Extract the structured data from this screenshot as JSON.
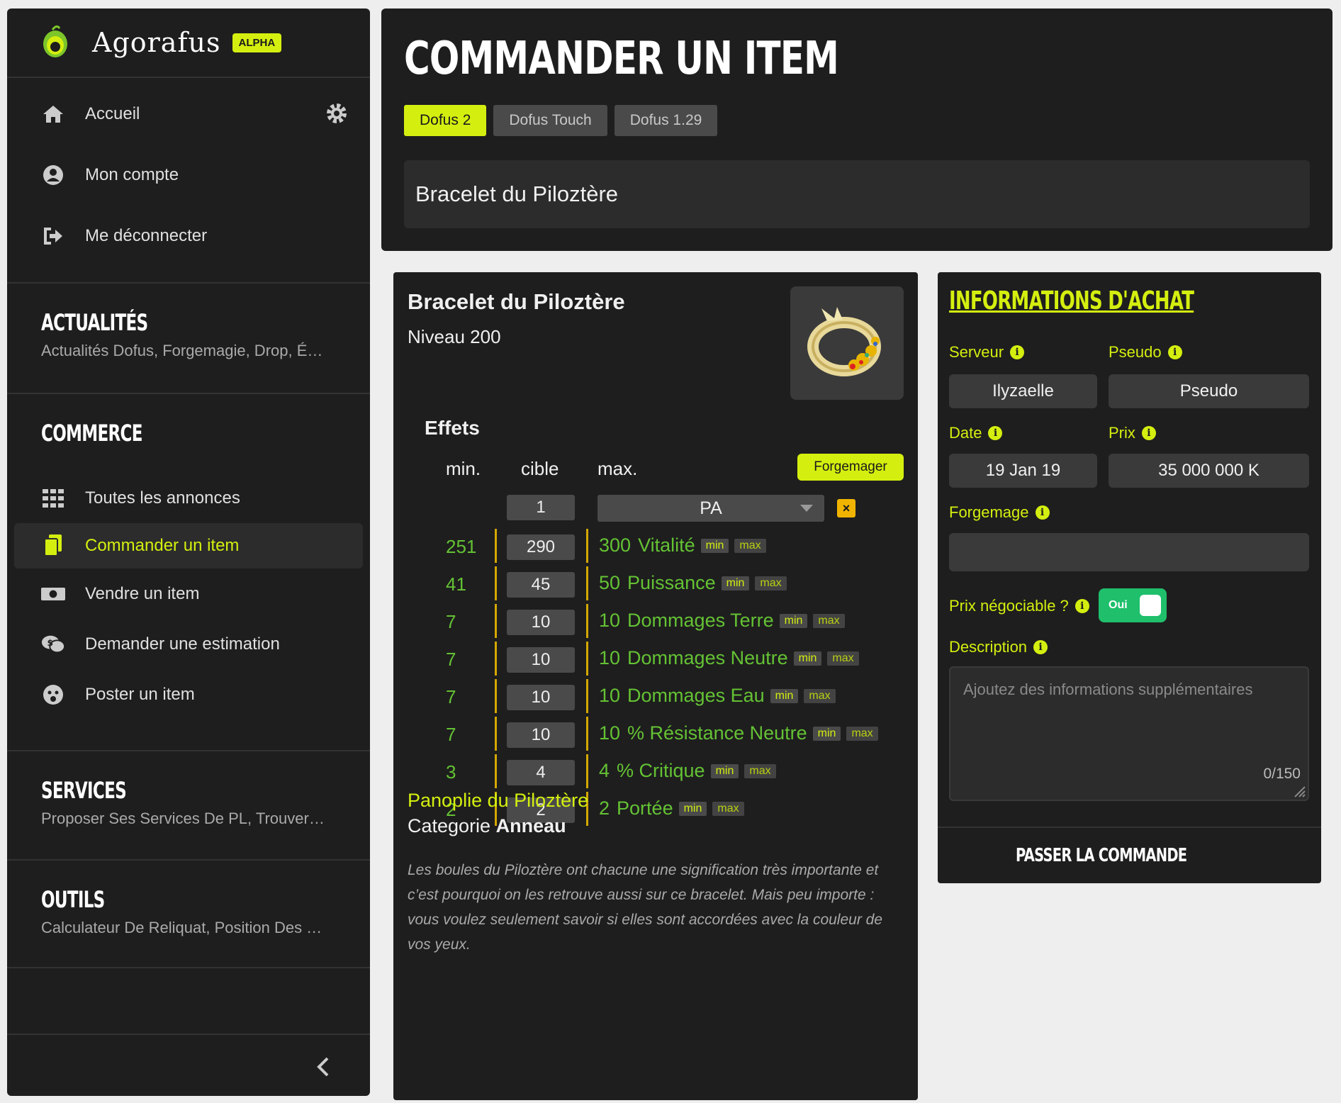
{
  "app": {
    "name": "Agorafus",
    "badge": "ALPHA",
    "accent": "#d4ef0f",
    "success": "#1fbf6b"
  },
  "sidebar": {
    "nav": [
      {
        "label": "Accueil",
        "icon": "home-icon"
      },
      {
        "label": "Mon compte",
        "icon": "user-circle-icon"
      },
      {
        "label": "Me déconnecter",
        "icon": "logout-icon"
      }
    ],
    "news": {
      "title": "ACTUALITÉS",
      "subtitle": "Actualités Dofus, Forgemagie, Drop, É…"
    },
    "commerce": {
      "title": "COMMERCE",
      "items": [
        {
          "label": "Toutes les annonces",
          "icon": "grid-icon"
        },
        {
          "label": "Commander un item",
          "icon": "copy-icon",
          "active": true
        },
        {
          "label": "Vendre un item",
          "icon": "money-icon"
        },
        {
          "label": "Demander une estimation",
          "icon": "chat-dollar-icon"
        },
        {
          "label": "Poster un item",
          "icon": "face-icon"
        }
      ]
    },
    "services": {
      "title": "SERVICES",
      "subtitle": "Proposer Ses Services De PL, Trouver…"
    },
    "tools": {
      "title": "OUTILS",
      "subtitle": "Calculateur De Reliquat, Position Des …"
    }
  },
  "header": {
    "title": "COMMANDER UN ITEM",
    "tabs": [
      {
        "label": "Dofus 2",
        "active": true
      },
      {
        "label": "Dofus Touch",
        "active": false
      },
      {
        "label": "Dofus 1.29",
        "active": false
      }
    ],
    "search_value": "Bracelet du Piloztère"
  },
  "item": {
    "name": "Bracelet du Piloztère",
    "level": "Niveau 200",
    "effects_title": "Effets",
    "columns": {
      "min": "min.",
      "target": "cible",
      "max": "max."
    },
    "forge_button": "Forgemager",
    "pa_row": {
      "target": "1",
      "select": "PA"
    },
    "effects": [
      {
        "min": "251",
        "target": "290",
        "max": "300",
        "name": "Vitalité"
      },
      {
        "min": "41",
        "target": "45",
        "max": "50",
        "name": "Puissance"
      },
      {
        "min": "7",
        "target": "10",
        "max": "10",
        "name": "Dommages Terre"
      },
      {
        "min": "7",
        "target": "10",
        "max": "10",
        "name": "Dommages Neutre"
      },
      {
        "min": "7",
        "target": "10",
        "max": "10",
        "name": "Dommages Eau"
      },
      {
        "min": "7",
        "target": "10",
        "max": "10",
        "name": "% Résistance Neutre"
      },
      {
        "min": "3",
        "target": "4",
        "max": "4",
        "name": "% Critique"
      },
      {
        "min": "2",
        "target": "2",
        "max": "2",
        "name": "Portée"
      }
    ],
    "chip_min": "min",
    "chip_max": "max",
    "panoplie": "Panoplie du Piloztère",
    "categorie_label": "Categorie",
    "categorie_value": "Anneau",
    "description": "Les boules du Piloztère ont chacune une signification très importante et c’est pourquoi on les retrouve aussi sur ce bracelet. Mais peu importe : vous voulez seulement savoir si elles sont accordées avec la couleur de vos yeux."
  },
  "purchase": {
    "title": "INFORMATIONS D'ACHAT",
    "server_label": "Serveur",
    "server_value": "Ilyzaelle",
    "pseudo_label": "Pseudo",
    "pseudo_value": "Pseudo",
    "date_label": "Date",
    "date_value": "19 Jan 19",
    "price_label": "Prix",
    "price_value": "35 000 000 K",
    "forge_label": "Forgemage",
    "forge_value": "",
    "negotiable_label": "Prix négociable ?",
    "negotiable_value": "Oui",
    "description_label": "Description",
    "description_placeholder": "Ajoutez des informations supplémentaires",
    "description_count": "0/150",
    "submit": "PASSER LA COMMANDE"
  }
}
